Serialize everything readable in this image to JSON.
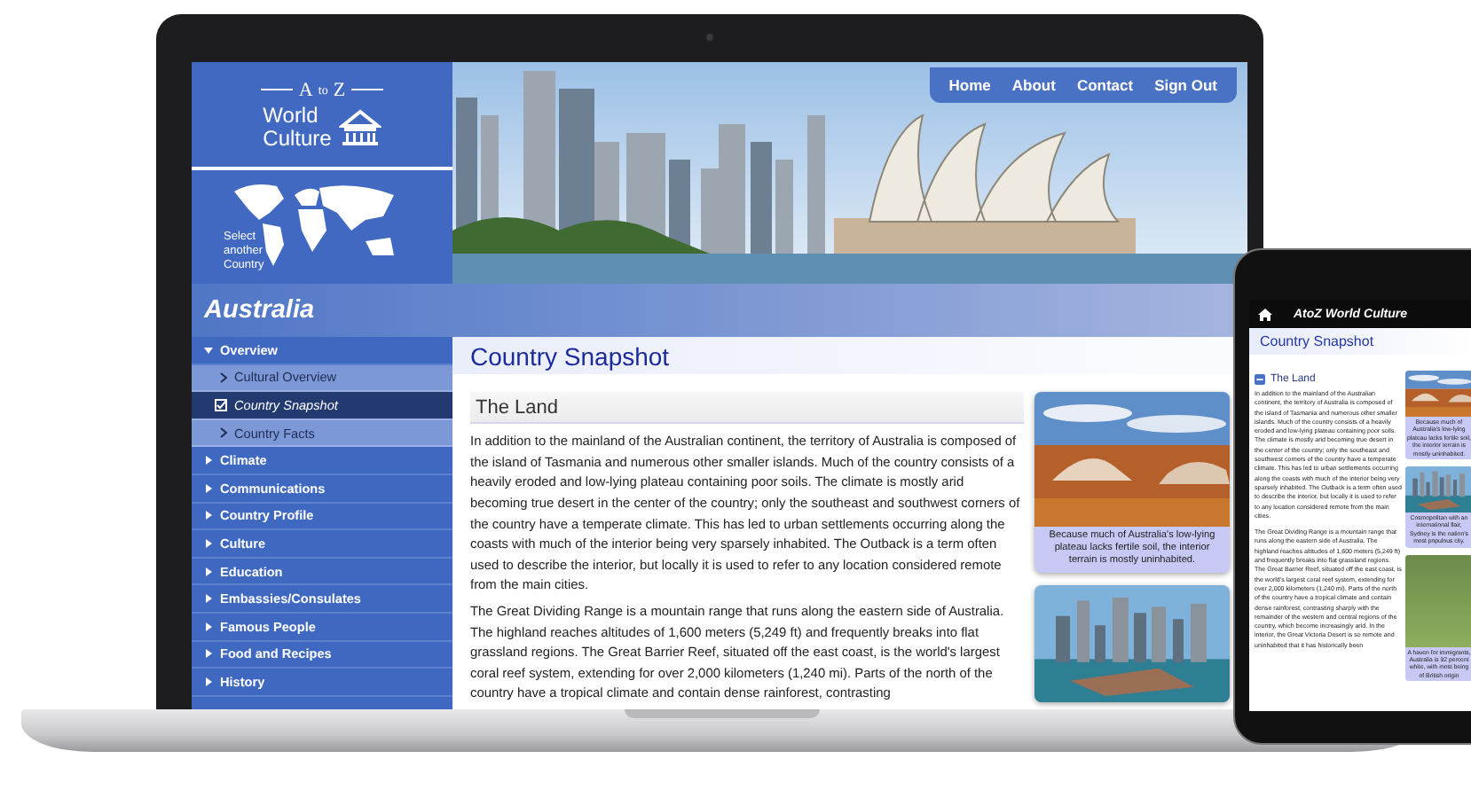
{
  "laptop": {
    "logo": {
      "letters": [
        "A",
        "to",
        "Z"
      ],
      "name_lines": [
        "World",
        "Culture"
      ]
    },
    "map_label": "Select another Country",
    "nav": [
      {
        "label": "Home"
      },
      {
        "label": "About"
      },
      {
        "label": "Contact"
      },
      {
        "label": "Sign Out"
      }
    ],
    "country": "Australia",
    "sidebar": [
      {
        "label": "Overview",
        "expanded": true,
        "children": [
          {
            "label": "Cultural Overview",
            "selected": false
          },
          {
            "label": "Country Snapshot",
            "selected": true
          },
          {
            "label": "Country Facts",
            "selected": false
          }
        ]
      },
      {
        "label": "Climate",
        "expanded": false
      },
      {
        "label": "Communications",
        "expanded": false
      },
      {
        "label": "Country Profile",
        "expanded": false
      },
      {
        "label": "Culture",
        "expanded": false
      },
      {
        "label": "Education",
        "expanded": false
      },
      {
        "label": "Embassies/Consulates",
        "expanded": false
      },
      {
        "label": "Famous People",
        "expanded": false
      },
      {
        "label": "Food and Recipes",
        "expanded": false
      },
      {
        "label": "History",
        "expanded": false
      }
    ],
    "page_title": "Country Snapshot",
    "section": {
      "title": "The Land",
      "paragraphs": [
        "In addition to the mainland of the Australian continent, the territory of Australia is composed of the island of Tasmania and numerous other smaller islands. Much of the country consists of a heavily eroded and low-lying plateau containing poor soils. The climate is mostly arid becoming true desert in the center of the country; only the southeast and southwest corners of the country have a temperate climate. This has led to urban settlements occurring along the coasts with much of the interior being very sparsely inhabited. The Outback is a term often used to describe the interior, but locally it is used to refer to any location considered remote from the main cities.",
        "The Great Dividing Range is a mountain range that runs along the eastern side of Australia. The highland reaches altitudes of 1,600 meters (5,249 ft) and frequently breaks into flat grassland regions. The Great Barrier Reef, situated off the east coast, is the world's largest coral reef system, extending for over 2,000 kilometers (1,240 mi). Parts of the north of the country have a tropical climate and contain dense rainforest, contrasting"
      ]
    },
    "figures": [
      {
        "kind": "desert",
        "caption": "Because much of Australia's low-lying plateau lacks fertile soil, the interior terrain is mostly uninhabited."
      },
      {
        "kind": "city"
      }
    ]
  },
  "phone": {
    "title": "AtoZ World Culture",
    "page_title": "Country Snapshot",
    "section": {
      "title": "The Land",
      "expanded": true,
      "paragraphs": [
        "In addition to the mainland of the Australian continent, the territory of Australia is composed of the island of Tasmania and numerous other smaller islands. Much of the country consists of a heavily eroded and low-lying plateau containing poor soils. The climate is mostly arid becoming true desert in the center of the country; only the southeast and southwest corners of the country have a temperate climate. This has led to urban settlements occurring along the coasts with much of the interior being very sparsely inhabited. The Outback is a term often used to describe the interior, but locally it is used to refer to any location considered remote from the main cities.",
        "The Great Dividing Range is a mountain range that runs along the eastern side of Australia. The highland reaches altitudes of 1,600 meters (5,249 ft) and frequently breaks into flat grassland regions. The Great Barrier Reef, situated off the east coast, is the world's largest coral reef system, extending for over 2,000 kilometers (1,240 mi). Parts of the north of the country have a tropical climate and contain dense rainforest, contrasting sharply with the remainder of the western and central regions of the country, which become increasingly arid. In the interior, the Great Victoria Desert is so remote and uninhabited that it has historically been"
      ]
    },
    "figures": [
      {
        "kind": "desert",
        "caption": "Because much of Australia's low-lying plateau lacks fertile soil, the interior terrain is mostly uninhabited."
      },
      {
        "kind": "city",
        "caption": "Cosmopolitan with an international flair, Sydney is the nation's most populous city."
      },
      {
        "kind": "person",
        "caption": "A haven for immigrants, Australia is 92 percent white, with most being of British origin"
      }
    ]
  }
}
